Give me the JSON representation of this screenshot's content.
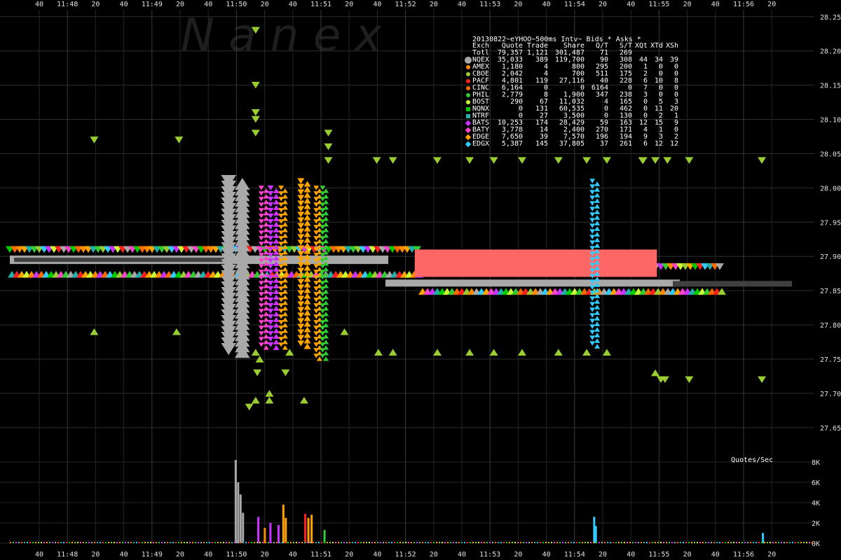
{
  "chart_data": {
    "type": "scatter",
    "title": "20130822~eYHOO~500ms Intv~ Bids * Asks *",
    "watermark": "N a n e x",
    "ylim": [
      27.61,
      28.26
    ],
    "y_ticks": [
      "28.25",
      "28.20",
      "28.15",
      "28.10",
      "28.05",
      "28.00",
      "27.95",
      "27.90",
      "27.85",
      "27.80",
      "27.75",
      "27.70",
      "27.65"
    ],
    "x_tick_labels": [
      "40",
      "11:48",
      "20",
      "40",
      "11:49",
      "20",
      "40",
      "11:50",
      "20",
      "40",
      "11:51",
      "20",
      "40",
      "11:52",
      "20",
      "40",
      "11:53",
      "20",
      "40",
      "11:54",
      "20",
      "40",
      "11:55",
      "20",
      "40",
      "11:56",
      "20"
    ],
    "grid": true,
    "legend_header": [
      "Exch",
      "Quote",
      "Trade",
      "Share",
      "Q/T",
      "S/T",
      "XQt",
      "XTd",
      "XSh"
    ],
    "legend_rows": [
      {
        "exch": "Totl",
        "quote": "79,357",
        "trade": "1,121",
        "share": "301,487",
        "qt": "71",
        "st": "269",
        "xqt": "",
        "xtd": "",
        "xsh": "",
        "color": "",
        "marker": "none"
      },
      {
        "exch": "NQEX",
        "quote": "35,033",
        "trade": "389",
        "share": "119,700",
        "qt": "90",
        "st": "308",
        "xqt": "44",
        "xtd": "34",
        "xsh": "39",
        "color": "#a9a9a9",
        "marker": "big-circle"
      },
      {
        "exch": "AMEX",
        "quote": "1,180",
        "trade": "4",
        "share": "800",
        "qt": "295",
        "st": "200",
        "xqt": "1",
        "xtd": "0",
        "xsh": "0",
        "color": "#ff8c00",
        "marker": "circle"
      },
      {
        "exch": "CBOE",
        "quote": "2,042",
        "trade": "4",
        "share": "700",
        "qt": "511",
        "st": "175",
        "xqt": "2",
        "xtd": "0",
        "xsh": "0",
        "color": "#9acd32",
        "marker": "circle"
      },
      {
        "exch": "PACF",
        "quote": "4,801",
        "trade": "119",
        "share": "27,116",
        "qt": "40",
        "st": "228",
        "xqt": "6",
        "xtd": "10",
        "xsh": "8",
        "color": "#ff2020",
        "marker": "circle"
      },
      {
        "exch": "CINC",
        "quote": "6,164",
        "trade": "0",
        "share": "0",
        "qt": "6164",
        "st": "0",
        "xqt": "7",
        "xtd": "0",
        "xsh": "0",
        "color": "#ff6a00",
        "marker": "circle"
      },
      {
        "exch": "PHIL",
        "quote": "2,779",
        "trade": "8",
        "share": "1,900",
        "qt": "347",
        "st": "238",
        "xqt": "3",
        "xtd": "0",
        "xsh": "0",
        "color": "#32cd32",
        "marker": "circle"
      },
      {
        "exch": "BOST",
        "quote": "290",
        "trade": "67",
        "share": "11,032",
        "qt": "4",
        "st": "165",
        "xqt": "0",
        "xtd": "5",
        "xsh": "3",
        "color": "#ccff33",
        "marker": "circle"
      },
      {
        "exch": "NQNX",
        "quote": "0",
        "trade": "131",
        "share": "60,535",
        "qt": "0",
        "st": "462",
        "xqt": "0",
        "xtd": "11",
        "xsh": "20",
        "color": "#00cc00",
        "marker": "square"
      },
      {
        "exch": "NTRF",
        "quote": "0",
        "trade": "27",
        "share": "3,500",
        "qt": "0",
        "st": "130",
        "xqt": "0",
        "xtd": "2",
        "xsh": "1",
        "color": "#20b2aa",
        "marker": "square"
      },
      {
        "exch": "BATS",
        "quote": "10,253",
        "trade": "174",
        "share": "28,429",
        "qt": "59",
        "st": "163",
        "xqt": "12",
        "xtd": "15",
        "xsh": "9",
        "color": "#cc33ff",
        "marker": "diamond"
      },
      {
        "exch": "BATY",
        "quote": "3,778",
        "trade": "14",
        "share": "2,400",
        "qt": "270",
        "st": "171",
        "xqt": "4",
        "xtd": "1",
        "xsh": "0",
        "color": "#ff44cc",
        "marker": "diamond"
      },
      {
        "exch": "EDGE",
        "quote": "7,650",
        "trade": "39",
        "share": "7,570",
        "qt": "196",
        "st": "194",
        "xqt": "9",
        "xtd": "3",
        "xsh": "2",
        "color": "#ffa500",
        "marker": "diamond"
      },
      {
        "exch": "EDGX",
        "quote": "5,387",
        "trade": "145",
        "share": "37,805",
        "qt": "37",
        "st": "261",
        "xqt": "6",
        "xtd": "12",
        "xsh": "12",
        "color": "#33ccff",
        "marker": "diamond"
      }
    ],
    "nbbo_mid": 27.895,
    "nbbo_mid_late": 27.86,
    "bid_band": 27.88,
    "ask_band": 27.91,
    "lone_asks": [
      {
        "t": 0.108,
        "p": 28.07
      },
      {
        "t": 0.213,
        "p": 28.07
      },
      {
        "t": 0.308,
        "p": 28.23
      },
      {
        "t": 0.308,
        "p": 28.15
      },
      {
        "t": 0.308,
        "p": 28.11
      },
      {
        "t": 0.308,
        "p": 28.1
      },
      {
        "t": 0.308,
        "p": 28.08
      },
      {
        "t": 0.398,
        "p": 28.08
      },
      {
        "t": 0.398,
        "p": 28.06
      },
      {
        "t": 0.398,
        "p": 28.04
      },
      {
        "t": 0.458,
        "p": 28.04
      },
      {
        "t": 0.478,
        "p": 28.04
      },
      {
        "t": 0.533,
        "p": 28.04
      },
      {
        "t": 0.573,
        "p": 28.04
      },
      {
        "t": 0.603,
        "p": 28.04
      },
      {
        "t": 0.638,
        "p": 28.04
      },
      {
        "t": 0.683,
        "p": 28.04
      },
      {
        "t": 0.718,
        "p": 28.04
      },
      {
        "t": 0.743,
        "p": 28.04
      },
      {
        "t": 0.788,
        "p": 28.04
      },
      {
        "t": 0.803,
        "p": 28.04
      },
      {
        "t": 0.818,
        "p": 28.04
      },
      {
        "t": 0.845,
        "p": 28.04
      },
      {
        "t": 0.935,
        "p": 28.04
      },
      {
        "t": 0.787,
        "p": 28.04
      },
      {
        "t": 0.31,
        "p": 27.73
      },
      {
        "t": 0.345,
        "p": 27.73
      },
      {
        "t": 0.81,
        "p": 27.72
      },
      {
        "t": 0.815,
        "p": 27.72
      },
      {
        "t": 0.845,
        "p": 27.72
      },
      {
        "t": 0.935,
        "p": 27.72
      },
      {
        "t": 0.3,
        "p": 27.68
      }
    ],
    "lone_bids": [
      {
        "t": 0.108,
        "p": 27.79
      },
      {
        "t": 0.21,
        "p": 27.79
      },
      {
        "t": 0.418,
        "p": 27.79
      },
      {
        "t": 0.308,
        "p": 27.76
      },
      {
        "t": 0.35,
        "p": 27.76
      },
      {
        "t": 0.46,
        "p": 27.76
      },
      {
        "t": 0.478,
        "p": 27.76
      },
      {
        "t": 0.533,
        "p": 27.76
      },
      {
        "t": 0.573,
        "p": 27.76
      },
      {
        "t": 0.603,
        "p": 27.76
      },
      {
        "t": 0.638,
        "p": 27.76
      },
      {
        "t": 0.683,
        "p": 27.76
      },
      {
        "t": 0.718,
        "p": 27.76
      },
      {
        "t": 0.743,
        "p": 27.76
      },
      {
        "t": 0.308,
        "p": 27.69
      },
      {
        "t": 0.325,
        "p": 27.69
      },
      {
        "t": 0.325,
        "p": 27.7
      },
      {
        "t": 0.368,
        "p": 27.69
      },
      {
        "t": 0.803,
        "p": 27.73
      },
      {
        "t": 0.313,
        "p": 27.75
      }
    ],
    "volume_axis_label": "Quotes/Sec",
    "volume_ticks": [
      "8K",
      "6K",
      "4K",
      "2K",
      "0K"
    ],
    "volume_ylim": [
      0,
      8000
    ],
    "volume_bars": [
      {
        "t": 0.282,
        "v": 8200,
        "color": "#a9a9a9"
      },
      {
        "t": 0.285,
        "v": 6000,
        "color": "#a9a9a9"
      },
      {
        "t": 0.288,
        "v": 4800,
        "color": "#a9a9a9"
      },
      {
        "t": 0.291,
        "v": 3000,
        "color": "#a9a9a9"
      },
      {
        "t": 0.31,
        "v": 2600,
        "color": "#cc33ff"
      },
      {
        "t": 0.318,
        "v": 1500,
        "color": "#ff8c00"
      },
      {
        "t": 0.325,
        "v": 2000,
        "color": "#cc33ff"
      },
      {
        "t": 0.335,
        "v": 1800,
        "color": "#cc33ff"
      },
      {
        "t": 0.341,
        "v": 3800,
        "color": "#ffa500"
      },
      {
        "t": 0.344,
        "v": 2500,
        "color": "#ffa500"
      },
      {
        "t": 0.368,
        "v": 2900,
        "color": "#ff2020"
      },
      {
        "t": 0.372,
        "v": 2500,
        "color": "#ffa500"
      },
      {
        "t": 0.376,
        "v": 2800,
        "color": "#ffa500"
      },
      {
        "t": 0.392,
        "v": 1300,
        "color": "#32cd32"
      },
      {
        "t": 0.726,
        "v": 2600,
        "color": "#33ccff"
      },
      {
        "t": 0.728,
        "v": 1700,
        "color": "#33ccff"
      },
      {
        "t": 0.935,
        "v": 1000,
        "color": "#33ccff"
      }
    ],
    "fast_columns": [
      {
        "t": 0.283,
        "p_low": 27.76,
        "p_high": 28.01,
        "color": "#a9a9a9",
        "width": 0.034
      },
      {
        "t": 0.318,
        "p_low": 27.77,
        "p_high": 28.0,
        "color": "#ff44cc",
        "width": 0.012
      },
      {
        "t": 0.33,
        "p_low": 27.77,
        "p_high": 28.0,
        "color": "#cc33ff",
        "width": 0.014
      },
      {
        "t": 0.342,
        "p_low": 27.77,
        "p_high": 28.0,
        "color": "#ffa500",
        "width": 0.01
      },
      {
        "t": 0.368,
        "p_low": 27.77,
        "p_high": 28.01,
        "color": "#ffa500",
        "width": 0.016
      },
      {
        "t": 0.385,
        "p_low": 27.75,
        "p_high": 28.0,
        "color": "#ffa500",
        "width": 0.008
      },
      {
        "t": 0.393,
        "p_low": 27.75,
        "p_high": 28.0,
        "color": "#32cd32",
        "width": 0.008
      },
      {
        "t": 0.728,
        "p_low": 27.77,
        "p_high": 28.01,
        "color": "#33ccff",
        "width": 0.012
      }
    ],
    "pacf_block": {
      "t_start": 0.505,
      "t_end": 0.805,
      "p_low": 27.87,
      "p_high": 27.89,
      "color": "#ff6666"
    }
  }
}
